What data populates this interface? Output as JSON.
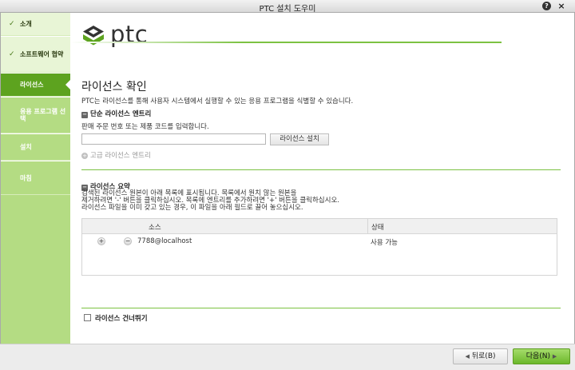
{
  "window": {
    "title": "PTC 설치 도우미",
    "help_glyph": "?",
    "close_glyph": "×"
  },
  "sidebar": {
    "steps": [
      {
        "label": "소개",
        "state": "done"
      },
      {
        "label": "소프트웨어 협약",
        "state": "done"
      },
      {
        "label": "라이선스",
        "state": "active"
      },
      {
        "label": "응용 프로그램 선택",
        "state": "pending"
      },
      {
        "label": "설치",
        "state": "pending"
      },
      {
        "label": "마침",
        "state": "pending"
      }
    ],
    "check_glyph": "✓"
  },
  "logo": {
    "text": "ptc"
  },
  "main": {
    "title": "라이선스 확인",
    "description": "PTC는 라이선스를 통해 사용자 시스템에서 실행할 수 있는 응용 프로그램을 식별할 수 있습니다.",
    "simple_entry": {
      "header": "단순 라이선스 엔트리",
      "label": "판매 주문 번호 또는 제품 코드를 입력합니다.",
      "input_value": "",
      "install_button": "라이선스 설치"
    },
    "advanced_entry": {
      "label": "고급 라이선스 엔트리"
    },
    "summary": {
      "header": "라이선스 요약",
      "lines": [
        "검색된 라이선스 원본이 아래 목록에 표시됩니다. 목록에서 원치 않는 원본을",
        "제거하려면 '-' 버튼을 클릭하십시오. 목록에 엔트리를 추가하려면 '+' 버튼을 클릭하십시오.",
        "라이선스 파일을 이미 갖고 있는 경우, 이 파일을 아래 필드로 끌어 놓으십시오."
      ],
      "table": {
        "columns": [
          "소스",
          "상태"
        ],
        "rows": [
          {
            "source": "7788@localhost",
            "status": "사용 가능"
          }
        ]
      }
    },
    "skip_label": "라이선스 건너뛰기"
  },
  "footer": {
    "back": "뒤로(B)",
    "next": "다음(N)"
  },
  "colors": {
    "accent": "#7cc242",
    "active_step": "#5da31f",
    "pending_step": "#b4dc83",
    "done_step": "#e8f5d6"
  }
}
